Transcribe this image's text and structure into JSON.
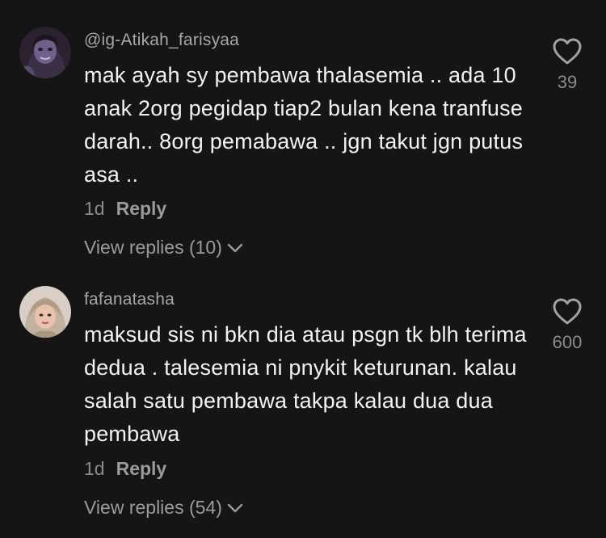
{
  "comments": [
    {
      "username": "@ig-Atikah_farisyaa",
      "text": "mak ayah sy pembawa thalasemia .. ada 10 anak 2org pegidap tiap2 bulan kena tranfuse darah.. 8org pemabawa .. jgn takut jgn putus asa ..",
      "time": "1d",
      "reply_label": "Reply",
      "view_replies": "View replies (10)",
      "likes": "39"
    },
    {
      "username": "fafanatasha",
      "text": "maksud sis ni bkn dia atau psgn tk blh terima dedua . talesemia ni pnykit keturunan. kalau salah satu pembawa takpa kalau dua dua pembawa",
      "time": "1d",
      "reply_label": "Reply",
      "view_replies": "View replies (54)",
      "likes": "600"
    }
  ],
  "colors": {
    "background": "#151515",
    "text": "#f2f2f2",
    "muted": "#8b8b8b"
  },
  "icons": {
    "like": "heart-outline-icon",
    "expand": "chevron-down-icon"
  }
}
